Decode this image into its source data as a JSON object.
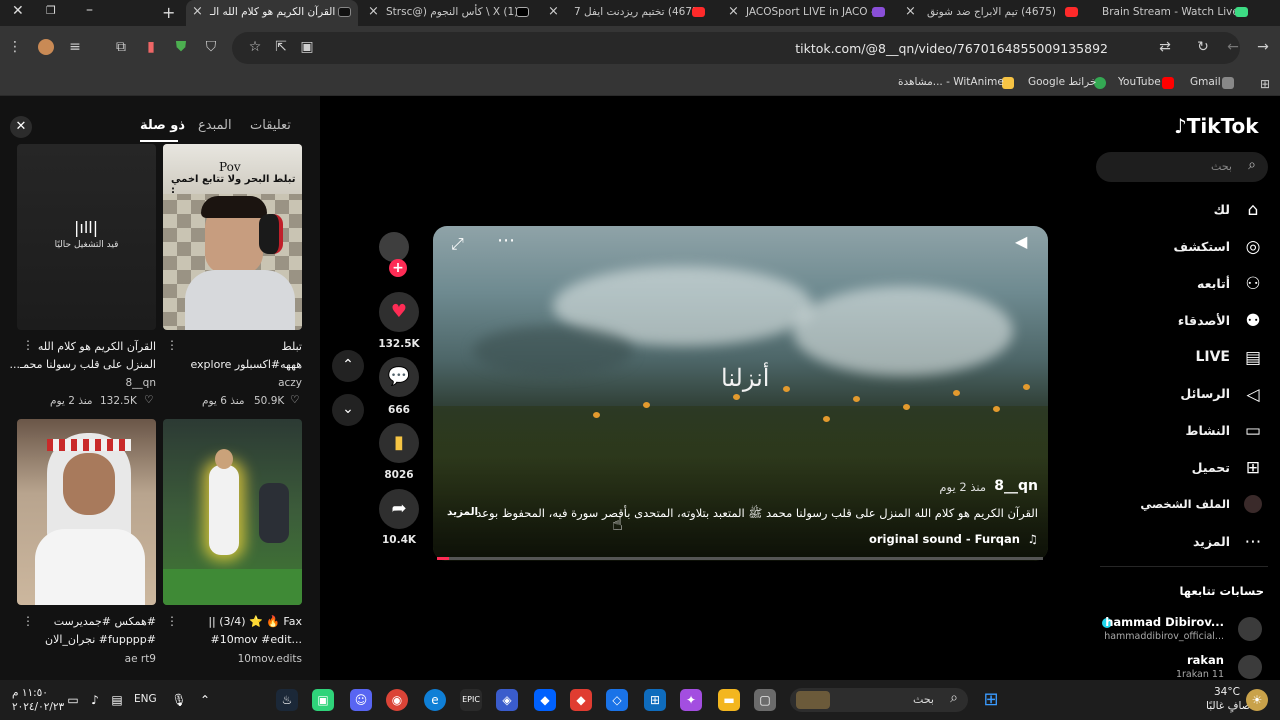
{
  "browser": {
    "tabs": [
      {
        "title": "Brain Stream - Watch Live",
        "favicon": "green"
      },
      {
        "title": "(4675) تيم الابراج ضد شونق",
        "favicon": "youtube"
      },
      {
        "title": "JACOSport LIVE in JACO -",
        "favicon": "purple"
      },
      {
        "title": "(4675) تختيم ريزدنت ايفل 7",
        "favicon": "youtube"
      },
      {
        "title": "(1) X \\ كأس النجوم (@Strsc",
        "favicon": "x"
      },
      {
        "title": "القرآن الكريم هو كلام الله الـ",
        "favicon": "tiktok",
        "active": true
      }
    ],
    "url": "tiktok.com/@8__qn/video/7670164855009135892",
    "bookmarks": [
      {
        "label": "Gmail",
        "color": "#ea4335"
      },
      {
        "label": "YouTube",
        "color": "#ff0000"
      },
      {
        "label": "خرائط Google",
        "color": "#34a853"
      },
      {
        "label": "مشاهدة... - WitAnime",
        "color": "#f6c344"
      }
    ]
  },
  "tiktok": {
    "logo_text": "TikTok",
    "search_placeholder": "بحث",
    "nav": [
      {
        "label": "لك",
        "icon": "home-icon"
      },
      {
        "label": "استكشف",
        "icon": "compass-icon"
      },
      {
        "label": "أتابعه",
        "icon": "following-icon"
      },
      {
        "label": "الأصدقاء",
        "icon": "friends-icon"
      },
      {
        "label": "LIVE",
        "icon": "live-icon"
      },
      {
        "label": "الرسائل",
        "icon": "messages-icon"
      },
      {
        "label": "النشاط",
        "icon": "activity-icon"
      },
      {
        "label": "تحميل",
        "icon": "upload-icon"
      },
      {
        "label": "الملف الشخصي",
        "icon": "profile-icon"
      },
      {
        "label": "المزيد",
        "icon": "more-icon"
      }
    ],
    "following_title": "حسابات تتابعها",
    "following": [
      {
        "name": "hammad Dibirov...",
        "handle": "hammaddibirov_official..."
      },
      {
        "name": "rakan",
        "handle": "1rakan 11"
      }
    ],
    "video": {
      "author": "8__qn",
      "time": "منذ 2 يوم",
      "overlay_text": "أنزلنا",
      "caption": "القرآن الكريم هو كلام الله المنزل على قلب رسولنا محمد ﷺ المتعبد بتلاوته، المتحدى بأقصر سورة فيه، المحفوظ بوعد",
      "more": "المزيد",
      "sound": "original sound - Furqan",
      "progress": 0.02
    },
    "actions": {
      "likes": "132.5K",
      "comments": "666",
      "saves": "8026",
      "shares": "10.4K"
    },
    "panel_tabs": [
      {
        "label": "تعليقات",
        "active": false
      },
      {
        "label": "المبدع",
        "active": false
      },
      {
        "label": "ذو صلة",
        "active": true
      }
    ],
    "related": [
      {
        "caption1": "القرآن الكريم هو كلام الله",
        "caption2": "المنزل على قلب رسولنا محمـ...",
        "author": "8__qn",
        "time": "منذ 2 يوم",
        "likes": "132.5K",
        "status": "قيد التشغيل حاليًا"
      },
      {
        "caption1": "تبلط",
        "caption2": "هههه#اكسبلور explore",
        "author": "aczy",
        "time": "منذ 6 يوم",
        "likes": "50.9K",
        "overlay1": "Pov",
        "overlay2": "تبلط البحر ولا تتابع اخمي :"
      },
      {
        "caption1": "#همكس #جمديرست",
        "caption2": "#fupppp# نجران_الان",
        "author": "ae rt9",
        "time": "",
        "likes": ""
      },
      {
        "caption1": "|| (3/4) ⭐ 🔥 Fax",
        "caption2": "#10mov #edit...",
        "author": "10mov.edits",
        "time": "",
        "likes": ""
      }
    ]
  },
  "taskbar": {
    "search_placeholder": "بحث",
    "lang": "ENG",
    "time": "١١:٥٠ م",
    "date": "٢٠٢٤/٠٢/٢٣",
    "weather_temp": "34°C",
    "weather_desc": "صافٍ غالبًا"
  }
}
